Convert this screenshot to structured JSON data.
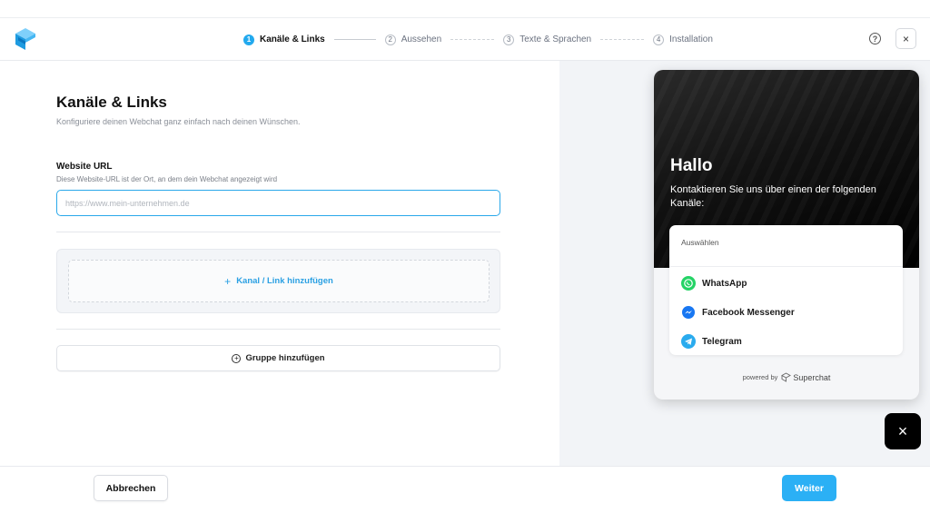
{
  "header": {
    "steps": [
      {
        "num": "1",
        "label": "Kanäle & Links"
      },
      {
        "num": "2",
        "label": "Aussehen"
      },
      {
        "num": "3",
        "label": "Texte & Sprachen"
      },
      {
        "num": "4",
        "label": "Installation"
      }
    ],
    "help_icon": "?",
    "close_icon": "×"
  },
  "form": {
    "title": "Kanäle & Links",
    "subtitle": "Konfiguriere deinen Webchat ganz einfach nach deinen Wünschen.",
    "url_label": "Website URL",
    "url_help": "Diese Website-URL ist der Ort, an dem dein Webchat angezeigt wird",
    "url_placeholder": "https://www.mein-unternehmen.de",
    "url_value": "",
    "add_channel_icon": "+",
    "add_channel_label": "Kanal / Link hinzufügen",
    "add_group_icon": "+",
    "add_group_label": "Gruppe hinzufügen"
  },
  "preview": {
    "greeting": "Hallo",
    "message": "Kontaktieren Sie uns über einen der folgenden Kanäle:",
    "select_label": "Auswählen",
    "channels": [
      {
        "label": "WhatsApp",
        "icon": "whatsapp-icon",
        "color": "#25D366"
      },
      {
        "label": "Facebook Messenger",
        "icon": "messenger-icon",
        "color": "#1877F2"
      },
      {
        "label": "Telegram",
        "icon": "telegram-icon",
        "color": "#2AABEE"
      }
    ],
    "powered_by": "powered by",
    "brand": "Superchat",
    "fab_icon": "×"
  },
  "footer": {
    "cancel_label": "Abbrechen",
    "next_label": "Weiter"
  },
  "colors": {
    "accent": "#2BB0F5",
    "active_step": "#22A9EE"
  }
}
